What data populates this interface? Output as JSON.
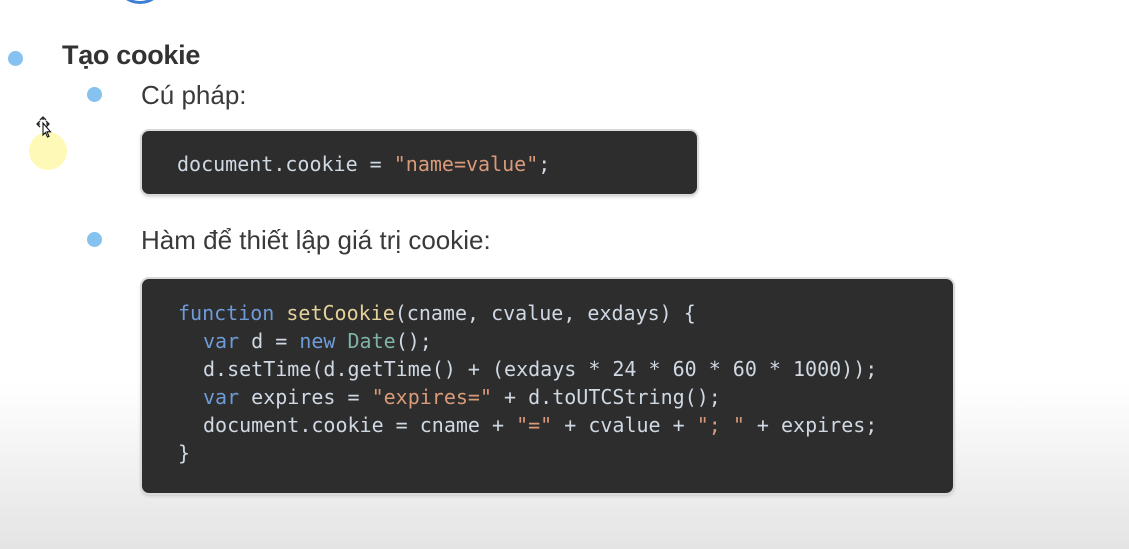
{
  "heading": "Tạo cookie",
  "items": [
    {
      "label": "Cú pháp:"
    },
    {
      "label": "Hàm để thiết lập giá trị cookie:"
    }
  ],
  "code1": {
    "line1": {
      "obj": "document.cookie = ",
      "str": "\"name=value\"",
      "end": ";"
    }
  },
  "code2": {
    "l1": {
      "kw": "function",
      "fn": "setCookie",
      "rest": "(cname, cvalue, exdays) {"
    },
    "l2": {
      "kw1": "var",
      "mid": " d = ",
      "kw2": "new",
      "cls": "Date",
      "end": "();"
    },
    "l3": {
      "text": "d.setTime(d.getTime() + (exdays * 24 * 60 * 60 * 1000));"
    },
    "l4": {
      "kw": "var",
      "mid": " expires = ",
      "str": "\"expires=\"",
      "end": " + d.toUTCString();"
    },
    "l5": {
      "a": "document.cookie = cname + ",
      "s1": "\"=\"",
      "b": " + cvalue + ",
      "s2": "\"; \"",
      "c": " + expires;"
    },
    "l6": {
      "text": "}"
    }
  },
  "colors": {
    "bullet": "#86c2ef",
    "code_bg": "#2d2d2d",
    "keyword": "#6e9bd8",
    "function": "#e4d29a",
    "string": "#d99a7a"
  },
  "icons": {
    "cursor": "move-cursor-icon"
  }
}
